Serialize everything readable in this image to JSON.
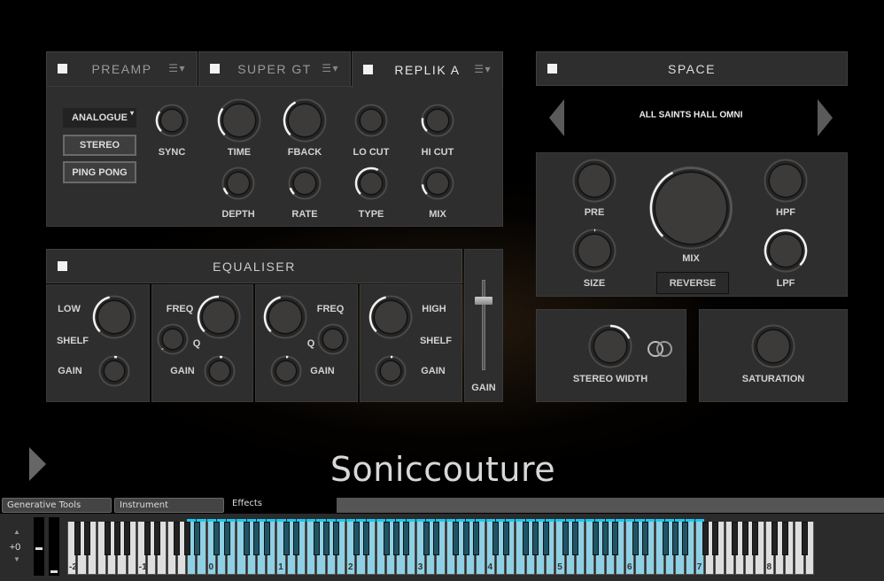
{
  "delay": {
    "tabs": [
      {
        "label": "PREAMP",
        "active": false
      },
      {
        "label": "SUPER GT",
        "active": false
      },
      {
        "label": "REPLIK A",
        "active": true
      }
    ],
    "mode_dropdown": "ANALOGUE",
    "stereo_button": "STEREO",
    "pingpong_button": "PING PONG",
    "knobs": [
      {
        "label": "SYNC",
        "value": 0.3
      },
      {
        "label": "TIME",
        "value": 0.3
      },
      {
        "label": "FBACK",
        "value": 0.4
      },
      {
        "label": "LO CUT",
        "value": 0
      },
      {
        "label": "HI CUT",
        "value": 0.2
      },
      {
        "label": "DEPTH",
        "value": 0.1
      },
      {
        "label": "RATE",
        "value": 0.1
      },
      {
        "label": "TYPE",
        "value": 0.6
      },
      {
        "label": "MIX",
        "value": 0.15
      }
    ]
  },
  "eq": {
    "title": "EQUALISER",
    "low": {
      "l1": "LOW",
      "l2": "SHELF",
      "gain": "GAIN",
      "freq_value": 0.45,
      "gain_value": 0.54
    },
    "band2": {
      "freq": "FREQ",
      "q": "Q",
      "gain": "GAIN",
      "freq_value": 0.5,
      "q_value": 0.01,
      "gain_value": 0.54
    },
    "band3": {
      "freq": "FREQ",
      "q": "Q",
      "gain": "GAIN",
      "freq_value": 0.45,
      "q_value": 0,
      "gain_value": 0.53
    },
    "high": {
      "l1": "HIGH",
      "l2": "SHELF",
      "gain": "GAIN",
      "freq_value": 0.45,
      "gain_value": 0.53
    },
    "master_gain": {
      "label": "GAIN",
      "value": 0.78
    }
  },
  "space": {
    "title": "SPACE",
    "preset": "ALL SAINTS HALL OMNI",
    "pre": {
      "label": "PRE",
      "value": 0
    },
    "size": {
      "label": "SIZE",
      "value": 0.51
    },
    "hpf": {
      "label": "HPF",
      "value": 0
    },
    "lpf": {
      "label": "LPF",
      "value": 1
    },
    "mix": {
      "label": "MIX",
      "value": 0.4
    },
    "reverse": "REVERSE",
    "stereo_width": {
      "label": "STEREO WIDTH",
      "value": 0.75
    },
    "saturation": {
      "label": "SATURATION",
      "value": 0
    }
  },
  "brand": "Soniccouture",
  "bottom_tabs": [
    {
      "label": "Generative Tools"
    },
    {
      "label": "Instrument"
    },
    {
      "label": "Effects",
      "active": true
    }
  ],
  "keyboard": {
    "octave_shift": "+0",
    "octave_labels": [
      "-2",
      "-1",
      "0",
      "1",
      "2",
      "3",
      "4",
      "5",
      "6",
      "7",
      "8"
    ],
    "active_range_midi": [
      21,
      108
    ],
    "highlight_color": "#8ed0e4",
    "active_marker_color": "#1ec8f0"
  }
}
